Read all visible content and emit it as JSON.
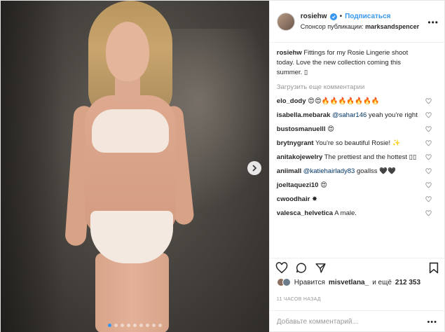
{
  "post": {
    "username": "rosiehw",
    "follow_label": "Подписаться",
    "separator": "•",
    "sponsor_prefix": "Спонсор публикации:",
    "sponsor_name": "marksandspencer",
    "more": "•••",
    "caption_text": "Fittings for my Rosie Lingerie shoot today. Love the new collection coming this summer. ▯",
    "load_more": "Загрузить еще комментарии",
    "comments": [
      {
        "user": "elo_dody",
        "text": "😍😍🔥🔥🔥🔥🔥🔥🔥"
      },
      {
        "user": "isabella.mebarak",
        "mention": "@sahar146",
        "text": " yeah you're right"
      },
      {
        "user": "bustosmanuelll",
        "text": "😍"
      },
      {
        "user": "brytnygrant",
        "text": "You're so beautiful Rosie! ✨"
      },
      {
        "user": "anitakojewelry",
        "text": "The prettiest and the hottest ▯▯"
      },
      {
        "user": "aniimall",
        "mention": "@katiehairlady83",
        "text": " goallss 🖤🖤"
      },
      {
        "user": "joeltaquezi10",
        "text": "😍"
      },
      {
        "user": "cwoodhair",
        "text": "✸"
      },
      {
        "user": "valesca_helvetica",
        "text": "A male."
      }
    ],
    "likes_prefix": "Нравится",
    "likes_user": "misvetlana_",
    "likes_and": "и ещё",
    "likes_count": "212 353",
    "time_ago": "11 ЧАСОВ НАЗАД",
    "add_comment_placeholder": "Добавьте комментарий...",
    "comment_more": "•••"
  },
  "icons": {
    "verified": "verified-badge-icon",
    "heart": "heart-icon",
    "comment": "comment-icon",
    "share": "share-icon",
    "bookmark": "bookmark-icon",
    "next": "chevron-right-icon"
  },
  "carousel": {
    "total_slides": 9,
    "active_slide": 1
  },
  "colors": {
    "accent": "#3897f0",
    "text": "#262626",
    "muted": "#999999"
  }
}
